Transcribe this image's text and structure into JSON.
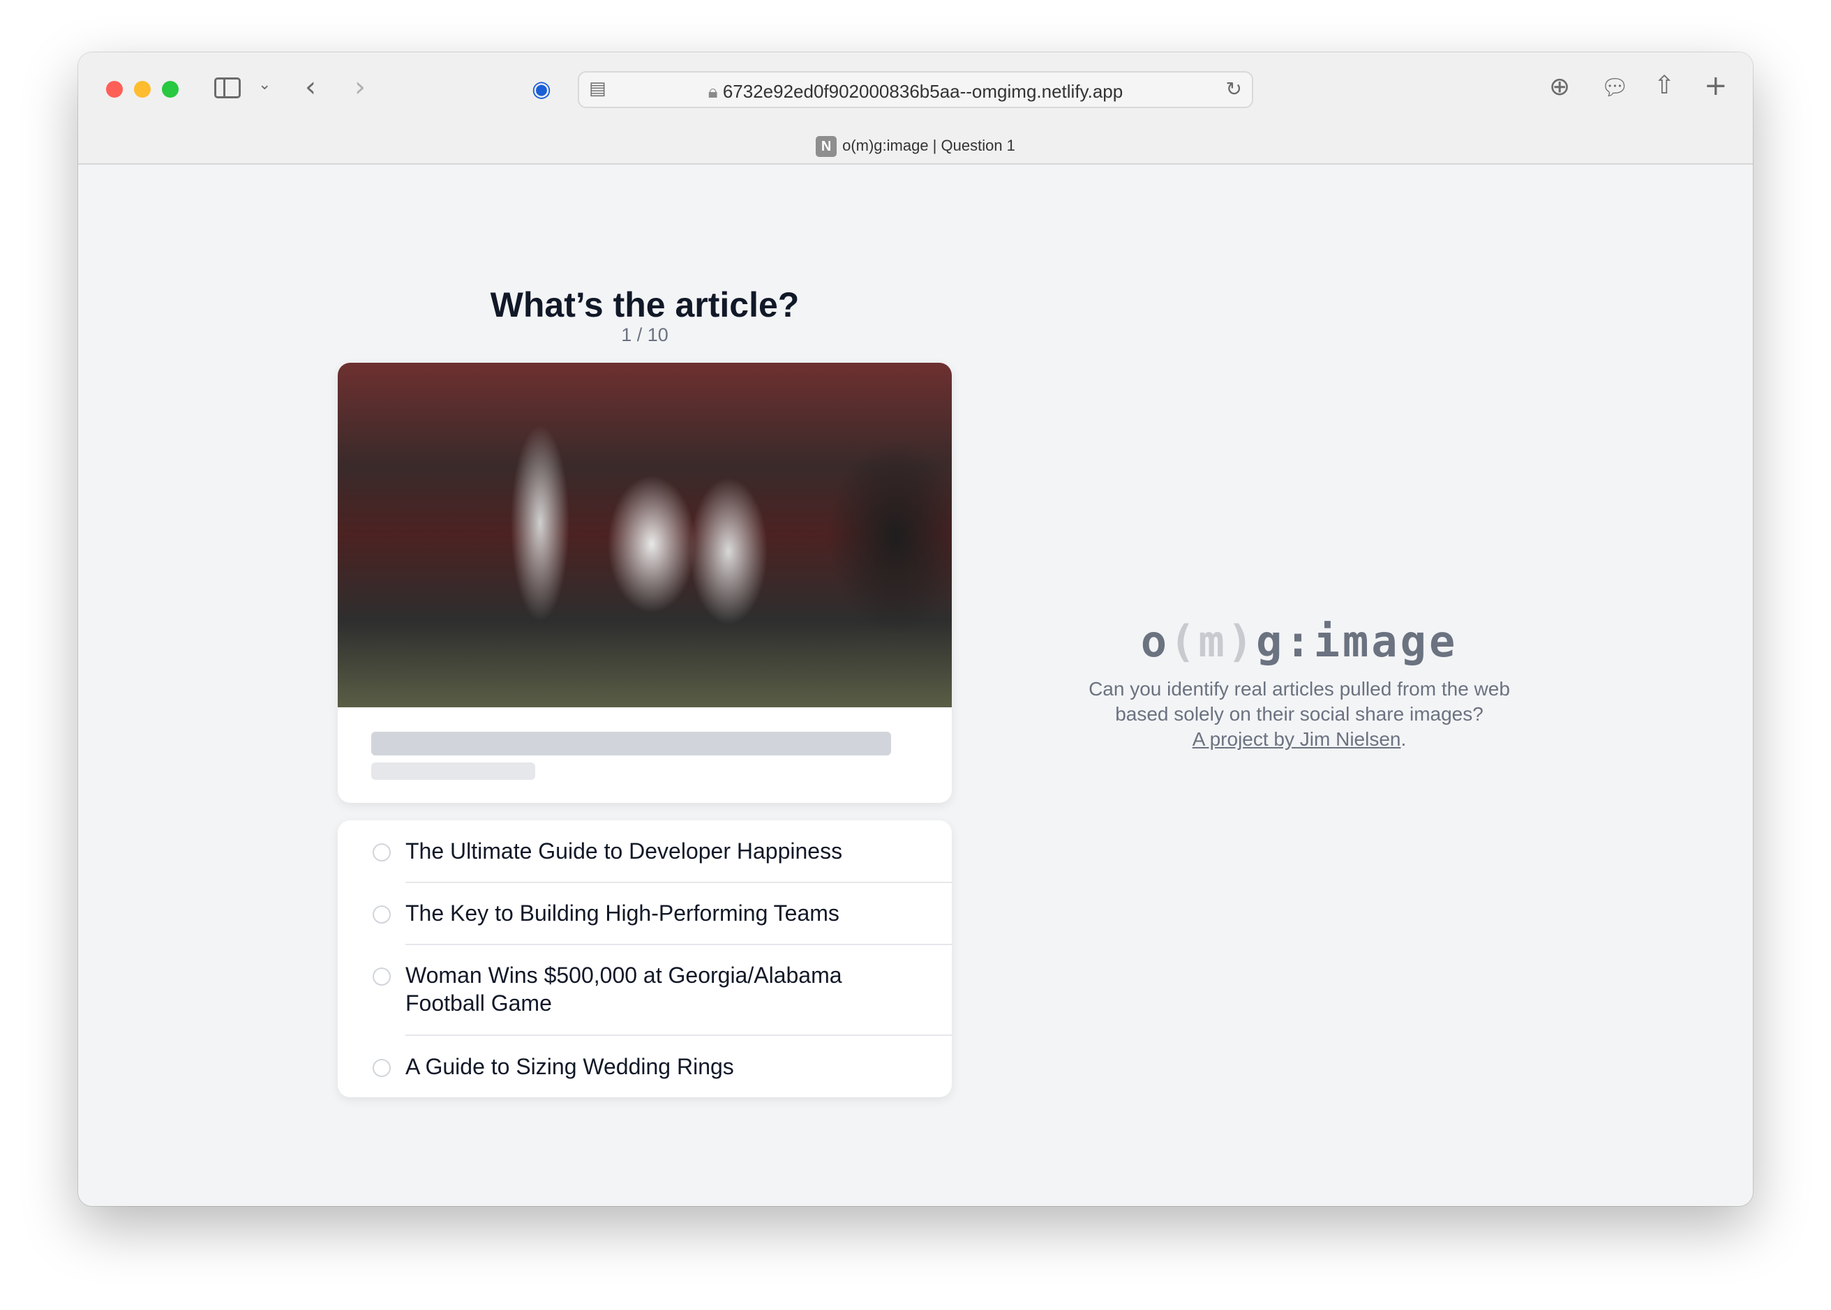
{
  "browser": {
    "url": "6732e92ed0f902000836b5aa--omgimg.netlify.app",
    "tab_title": "o(m)g:image | Question 1",
    "tab_favicon": "N",
    "traffic_lights": [
      "#fe5f57",
      "#febc2e",
      "#28c840"
    ]
  },
  "quiz": {
    "title": "What’s the article?",
    "progress": "1 / 10",
    "options": [
      "The Ultimate Guide to Developer Happiness",
      "The Key to Building High-Performing Teams",
      "Woman Wins $500,000 at Georgia/Alabama Football Game",
      "A Guide to Sizing Wedding Rings"
    ]
  },
  "sidebar": {
    "logo": {
      "pre": "o",
      "paren": "(m)",
      "post": "g:image"
    },
    "description": "Can you identify real articles pulled from the web based solely on their social share images?",
    "link": "A project by Jim Nielsen",
    "link_suffix": "."
  }
}
